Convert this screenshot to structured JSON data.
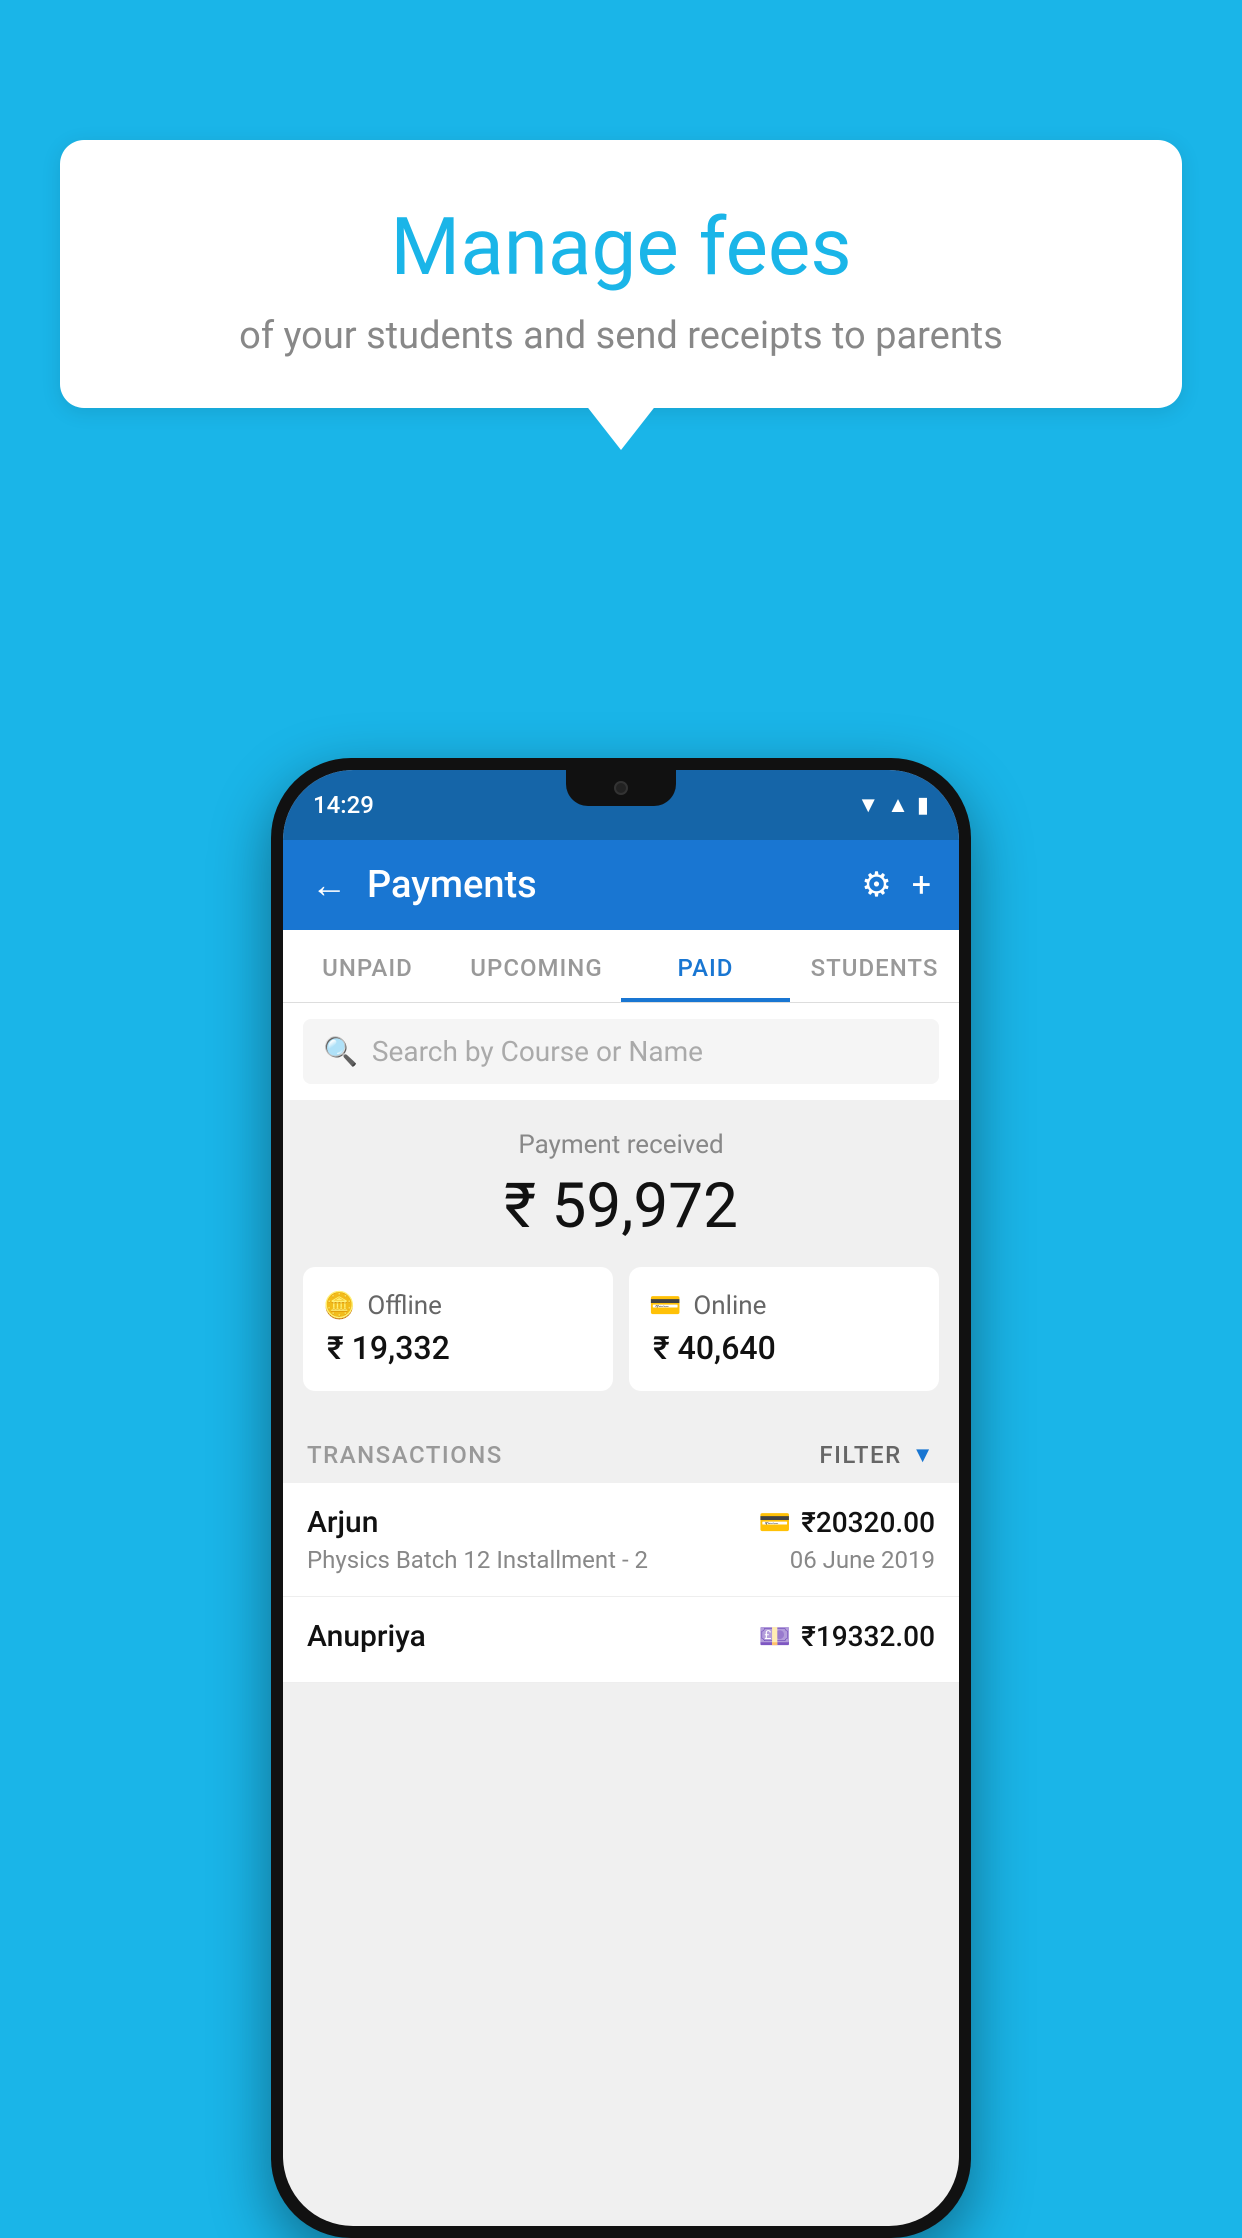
{
  "background_color": "#1ab5e8",
  "bubble": {
    "title": "Manage fees",
    "subtitle": "of your students and send receipts to parents"
  },
  "status_bar": {
    "time": "14:29",
    "icons": [
      "wifi",
      "signal",
      "battery"
    ]
  },
  "header": {
    "title": "Payments",
    "back_label": "←",
    "settings_icon": "⚙",
    "add_icon": "+"
  },
  "tabs": [
    {
      "label": "UNPAID",
      "active": false
    },
    {
      "label": "UPCOMING",
      "active": false
    },
    {
      "label": "PAID",
      "active": true
    },
    {
      "label": "STUDENTS",
      "active": false
    }
  ],
  "search": {
    "placeholder": "Search by Course or Name"
  },
  "payment_summary": {
    "label": "Payment received",
    "total_amount": "₹ 59,972",
    "cards": [
      {
        "icon": "💳",
        "type": "Offline",
        "amount": "₹ 19,332"
      },
      {
        "icon": "💳",
        "type": "Online",
        "amount": "₹ 40,640"
      }
    ]
  },
  "transactions": {
    "label": "TRANSACTIONS",
    "filter_label": "FILTER",
    "rows": [
      {
        "name": "Arjun",
        "amount": "₹20320.00",
        "course": "Physics Batch 12 Installment - 2",
        "date": "06 June 2019",
        "payment_icon": "💳"
      },
      {
        "name": "Anupriya",
        "amount": "₹19332.00",
        "course": "",
        "date": "",
        "payment_icon": "💷"
      }
    ]
  }
}
